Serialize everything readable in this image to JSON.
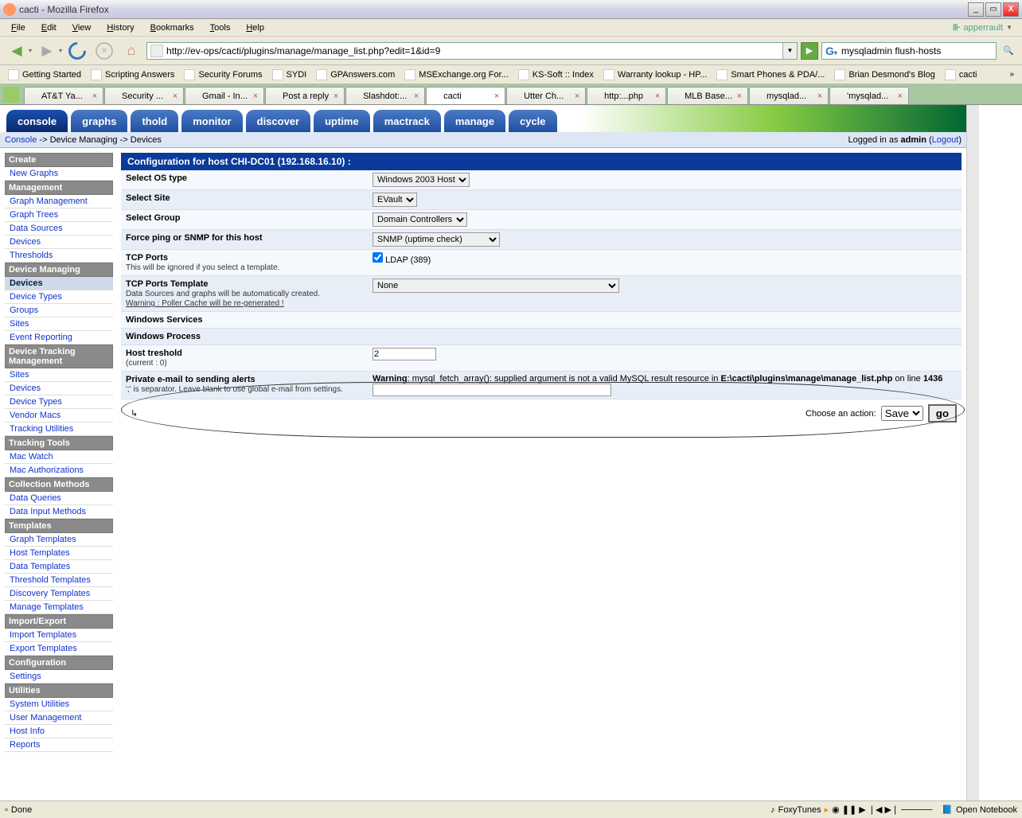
{
  "window": {
    "title": "cacti - Mozilla Firefox"
  },
  "menu": [
    "File",
    "Edit",
    "View",
    "History",
    "Bookmarks",
    "Tools",
    "Help"
  ],
  "user_badge": "apperrault",
  "url": "http://ev-ops/cacti/plugins/manage/manage_list.php?edit=1&id=9",
  "search": {
    "value": "mysqladmin flush-hosts"
  },
  "bookmarks": [
    "Getting Started",
    "Scripting Answers",
    "Security Forums",
    "SYDI",
    "GPAnswers.com",
    "MSExchange.org For...",
    "KS-Soft :: Index",
    "Warranty lookup - HP...",
    "Smart Phones & PDA/...",
    "Brian Desmond's Blog",
    "cacti"
  ],
  "tabs": [
    {
      "label": "AT&T Ya..."
    },
    {
      "label": "Security ..."
    },
    {
      "label": "Gmail - In..."
    },
    {
      "label": "Post a reply"
    },
    {
      "label": "Slashdot:..."
    },
    {
      "label": "cacti",
      "active": true
    },
    {
      "label": "Utter Ch..."
    },
    {
      "label": "http:...php"
    },
    {
      "label": "MLB Base..."
    },
    {
      "label": "mysqlad..."
    },
    {
      "label": "'mysqlad..."
    }
  ],
  "cacti_tabs": [
    "console",
    "graphs",
    "thold",
    "monitor",
    "discover",
    "uptime",
    "mactrack",
    "manage",
    "cycle"
  ],
  "cacti_active_tab": "console",
  "breadcrumb": {
    "a": "Console",
    "b": "Device Managing",
    "c": "Devices"
  },
  "login_status": {
    "prefix": "Logged in as ",
    "user": "admin",
    "logout": "Logout"
  },
  "nav": {
    "Create": [
      "New Graphs"
    ],
    "Management": [
      "Graph Management",
      "Graph Trees",
      "Data Sources",
      "Devices",
      "Thresholds"
    ],
    "Device Managing": [
      {
        "label": "Devices",
        "sel": true
      },
      "Device Types",
      "Groups",
      "Sites",
      "Event Reporting"
    ],
    "Device Tracking Management": [
      "Sites",
      "Devices",
      "Device Types",
      "Vendor Macs",
      "Tracking Utilities"
    ],
    "Tracking Tools": [
      "Mac Watch",
      "Mac Authorizations"
    ],
    "Collection Methods": [
      "Data Queries",
      "Data Input Methods"
    ],
    "Templates": [
      "Graph Templates",
      "Host Templates",
      "Data Templates",
      "Threshold Templates",
      "Discovery Templates",
      "Manage Templates"
    ],
    "Import/Export": [
      "Import Templates",
      "Export Templates"
    ],
    "Configuration": [
      "Settings"
    ],
    "Utilities": [
      "System Utilities",
      "User Management",
      "Host Info",
      "Reports"
    ]
  },
  "panel_title": "Configuration for host CHI-DC01 (192.168.16.10) :",
  "form": {
    "os_label": "Select OS type",
    "os_value": "Windows 2003 Host",
    "site_label": "Select Site",
    "site_value": "EVault",
    "group_label": "Select Group",
    "group_value": "Domain Controllers",
    "ping_label": "Force ping or SNMP for this host",
    "ping_value": "SNMP (uptime check)",
    "tcp_label": "TCP Ports",
    "tcp_sub": "This will be ignored if you select a template.",
    "ldap_label": "LDAP (389)",
    "tpl_label": "TCP Ports Template",
    "tpl_sub1": "Data Sources and graphs will be automatically created.",
    "tpl_sub2": "Warning : Poller Cache will be re-generated !",
    "tpl_value": "None",
    "ws_label": "Windows Services",
    "wp_label": "Windows Process",
    "th_label": "Host treshold",
    "th_sub": "(current : 0)",
    "th_value": "2",
    "em_label": "Private e-mail to sending alerts",
    "em_sub": "';' is separator. Leave blank to use global e-mail from settings.",
    "warn_prefix": "Warning",
    "warn_text": ": mysql_fetch_array(): supplied argument is not a valid MySQL result resource in ",
    "warn_file": "E:\\cacti\\plugins\\manage\\manage_list.php",
    "warn_line_prefix": " on line ",
    "warn_line": "1436",
    "em_value": ""
  },
  "action": {
    "label": "Choose an action:",
    "value": "Save",
    "go": "go"
  },
  "status": {
    "done": "Done",
    "foxy": "FoxyTunes",
    "notebook": "Open Notebook"
  }
}
